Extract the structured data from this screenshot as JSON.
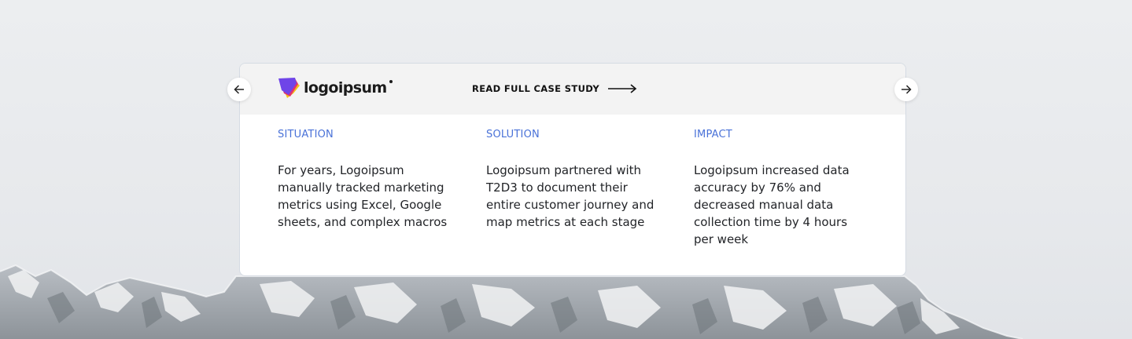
{
  "brand": {
    "logo_text": "logoipsum",
    "colors": {
      "purple": "#6f45e8",
      "yellow": "#f5c418",
      "pink": "#e2336d"
    }
  },
  "header": {
    "cta_label": "READ FULL CASE STUDY",
    "cta_icon": "long-arrow-right-icon"
  },
  "columns": [
    {
      "heading": "SITUATION",
      "body": "For years, Logoipsum manually tracked marketing metrics using Excel, Google sheets, and complex macros"
    },
    {
      "heading": "SOLUTION",
      "body": "Logoipsum partnered with T2D3 to document their entire customer journey and map metrics at each stage"
    },
    {
      "heading": "IMPACT",
      "body": "Logoipsum increased data accuracy by 76% and decreased manual data collection time by 4 hours per week"
    }
  ],
  "nav": {
    "prev_icon": "arrow-left-icon",
    "next_icon": "arrow-right-icon"
  },
  "theme": {
    "accent": "#4a72d8",
    "text": "#222428"
  }
}
